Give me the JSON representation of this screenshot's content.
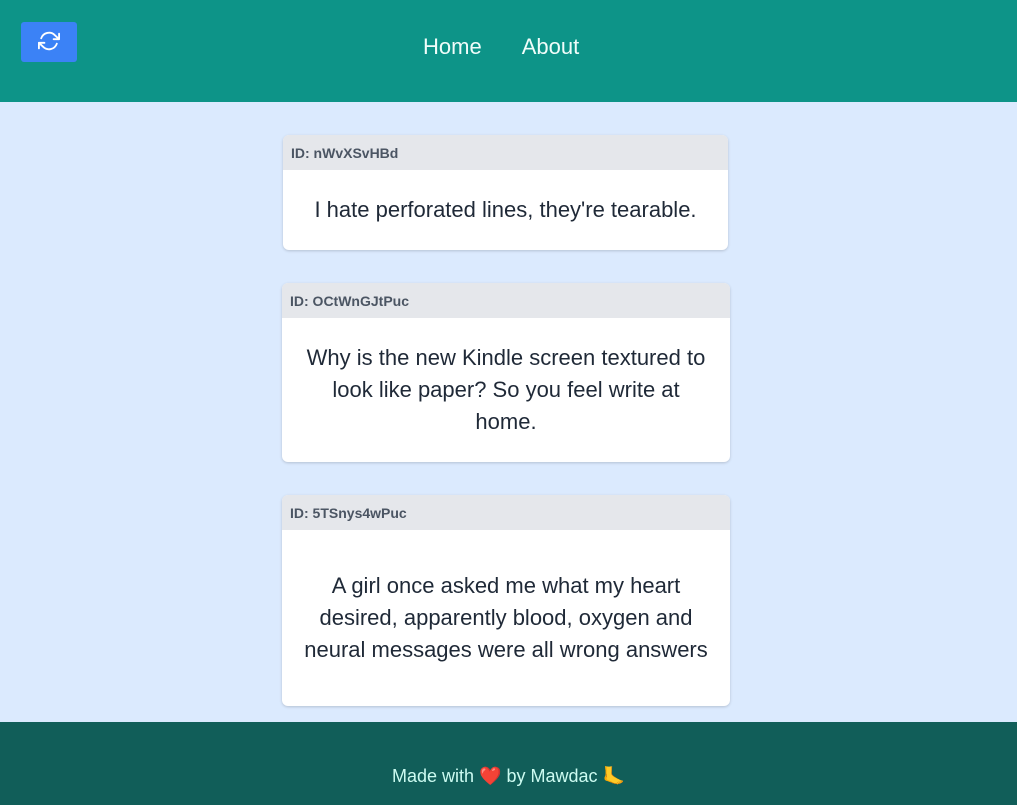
{
  "header": {
    "refresh_icon": "refresh-icon",
    "nav": [
      {
        "label": "Home"
      },
      {
        "label": "About"
      }
    ]
  },
  "cards": [
    {
      "id_label": "ID: nWvXSvHBd",
      "text": "I hate perforated lines, they're tearable."
    },
    {
      "id_label": "ID: OCtWnGJtPuc",
      "text": "Why is the new Kindle screen textured to look like paper? So you feel write at home."
    },
    {
      "id_label": "ID: 5TSnys4wPuc",
      "text": "A girl once asked me what my heart desired, apparently blood, oxygen and neural messages were all wrong answers"
    }
  ],
  "footer": {
    "prefix": "Made with",
    "heart": "❤️",
    "middle": "by Mawdac",
    "foot": "🦶"
  },
  "colors": {
    "header_bg": "#0d9488",
    "refresh_button_bg": "#3b82f6",
    "page_bg": "#dbeafe",
    "footer_bg": "#115e59"
  }
}
